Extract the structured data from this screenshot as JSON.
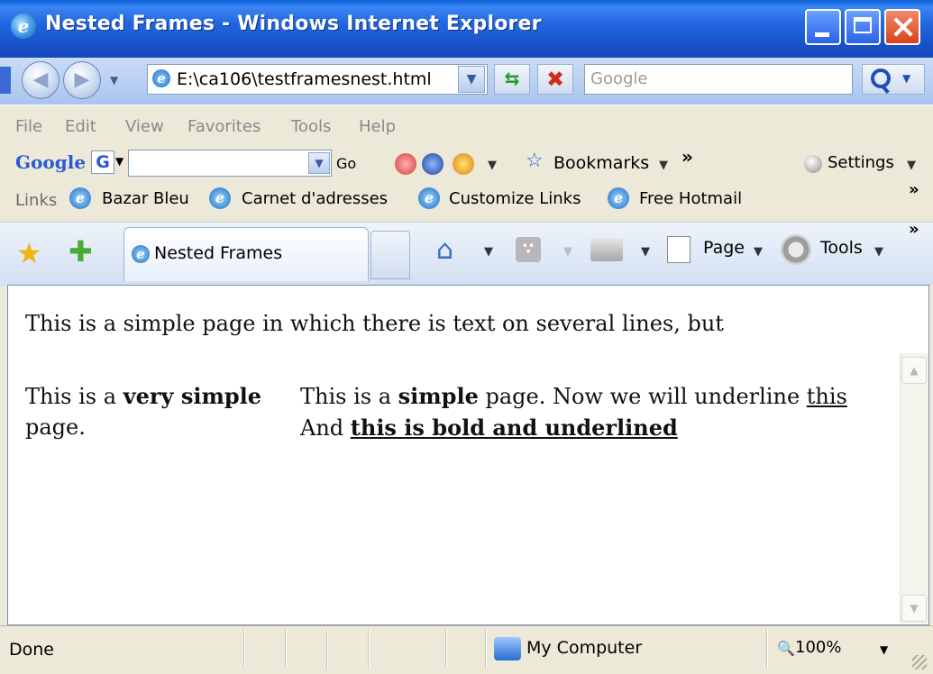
{
  "window": {
    "title": "Nested Frames - Windows Internet Explorer",
    "icon": "ie-icon"
  },
  "address": {
    "url": "E:\\ca106\\testframesnest.html",
    "search_placeholder": "Google"
  },
  "menu": [
    "File",
    "Edit",
    "View",
    "Favorites",
    "Tools",
    "Help"
  ],
  "google_toolbar": {
    "logo": "Google",
    "badge": "G",
    "go": "Go",
    "bookmarks": "Bookmarks",
    "chevron": "»",
    "settings": "Settings"
  },
  "links_bar": {
    "label": "Links",
    "items": [
      "Bazar Bleu",
      "Carnet d'adresses",
      "Customize Links",
      "Free Hotmail"
    ],
    "chevron": "»"
  },
  "tabs": {
    "active_label": "Nested Frames"
  },
  "command_bar": {
    "page": "Page",
    "tools": "Tools",
    "chevron": "»"
  },
  "content": {
    "top_frame": "This is a simple page in which there is text on several lines, but",
    "left_frame": {
      "line1_pre": "This is a ",
      "line1_bold": "very simple",
      "line2": "page."
    },
    "right_frame": {
      "line1_pre": "This is a ",
      "line1_bold": "simple",
      "line1_mid": " page. Now we will underline ",
      "line1_under": "this",
      "line2_pre": "And ",
      "line2_boldunder": "this is bold and underlined"
    }
  },
  "status": {
    "text": "Done",
    "zone": "My Computer",
    "zoom": "100%"
  }
}
